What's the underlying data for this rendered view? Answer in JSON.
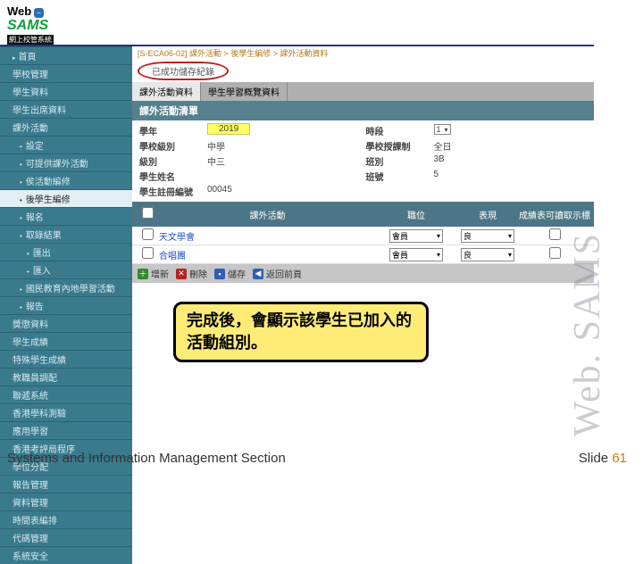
{
  "logo": {
    "web": "Web",
    "sams": "SAMS",
    "sub": "網上校管系統"
  },
  "sidebar": {
    "items": [
      {
        "label": "首頁",
        "cls": "first-main"
      },
      {
        "label": "學校管理"
      },
      {
        "label": "學生資料"
      },
      {
        "label": "學生出席資料"
      },
      {
        "label": "課外活動"
      },
      {
        "label": "設定",
        "sub": true
      },
      {
        "label": "可提供課外活動",
        "sub": true
      },
      {
        "label": "侯活動編修",
        "sub": true
      },
      {
        "label": "後學生編修",
        "sub": true,
        "active": true
      },
      {
        "label": "報名",
        "sub": true
      },
      {
        "label": "取錄結果",
        "sub": true
      },
      {
        "label": "匯出",
        "subsub": true
      },
      {
        "label": "匯入",
        "subsub": true
      },
      {
        "label": "國民教育內地學習活動",
        "sub": true
      },
      {
        "label": "報告",
        "sub": true
      },
      {
        "label": "獎懲資料"
      },
      {
        "label": "學生成績"
      },
      {
        "label": "特殊學生成績"
      },
      {
        "label": "教職員調配"
      },
      {
        "label": "聯遞系統"
      },
      {
        "label": "香港學科測驗"
      },
      {
        "label": "應用學習"
      },
      {
        "label": "香港考評局程序"
      },
      {
        "label": "學位分配"
      },
      {
        "label": "報告管理"
      },
      {
        "label": "資料管理"
      },
      {
        "label": "時間表編排"
      },
      {
        "label": "代碼管理"
      },
      {
        "label": "系統安全"
      }
    ]
  },
  "breadcrumb": "[S-ECA06-02] 課外活動 > 後學生編修 > 課外活動資料",
  "success_msg": "已成功儲存紀錄",
  "tabs": [
    {
      "label": "課外活動資料",
      "active": true
    },
    {
      "label": "學生學習概覽資料"
    }
  ],
  "section_title": "課外活動清單",
  "info": {
    "year_label": "學年",
    "year_value": "2019",
    "period_label": "時段",
    "period_value": "1",
    "level_label": "學校級別",
    "level_value": "中學",
    "schedule_label": "學校授課制",
    "schedule_value": "全日",
    "class_label": "級別",
    "class_value": "中三",
    "classno_label": "班別",
    "classno_value": "3B",
    "name_label": "學生姓名",
    "name_value": "",
    "seat_label": "班號",
    "seat_value": "5",
    "regno_label": "學生註冊編號",
    "regno_value": "00045"
  },
  "table": {
    "headers": [
      "",
      "課外活動",
      "職位",
      "表現",
      "成績表可讀取示標"
    ],
    "rows": [
      {
        "name": "天文學會",
        "role": "會員",
        "perf": "良"
      },
      {
        "name": "合唱團",
        "role": "會員",
        "perf": "良"
      }
    ]
  },
  "actions": {
    "add": "增新",
    "delete": "刪除",
    "save": "儲存",
    "back": "返回前頁"
  },
  "callout": "完成後，會顯示該學生已加入的活動組別。",
  "watermark": "Web. SAMS",
  "footer_title": "Systems and Information Management Section",
  "footer_slide_label": "Slide ",
  "footer_slide_num": "61"
}
